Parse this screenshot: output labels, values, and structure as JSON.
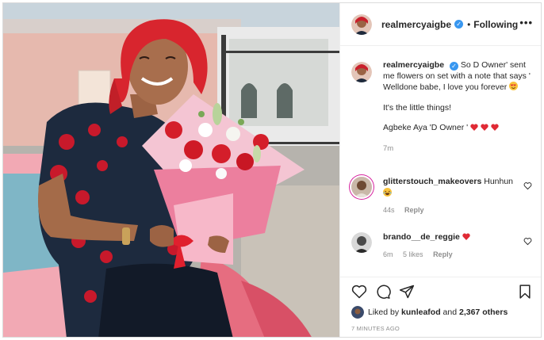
{
  "post": {
    "author": "realmercyaigbe",
    "follow_state": "Following",
    "dot_separator": "•",
    "more_icon": "more-horizontal-icon"
  },
  "caption": {
    "author": "realmercyaigbe",
    "line1": "So D Owner' sent me flowers on set with a note that says ' Welldone babe, I love you forever",
    "line2": "It's the little things!",
    "line3": "Agbeke Aya 'D Owner '",
    "time": "7m"
  },
  "comments": [
    {
      "user": "glitterstouch_makeovers",
      "text": "Hunhun",
      "time": "44s",
      "likes": "",
      "reply": "Reply"
    },
    {
      "user": "brando__de_reggie",
      "text": "",
      "time": "6m",
      "likes": "5 likes",
      "reply": "Reply"
    }
  ],
  "likes": {
    "prefix": "Liked by",
    "user": "kunleafod",
    "conj": "and",
    "count": "2,367 others"
  },
  "timestamp": "7 MINUTES AGO",
  "colors": {
    "verified": "#3897f0",
    "heart_red": "#ed4956",
    "text": "#262626",
    "muted": "#8e8e8e"
  }
}
